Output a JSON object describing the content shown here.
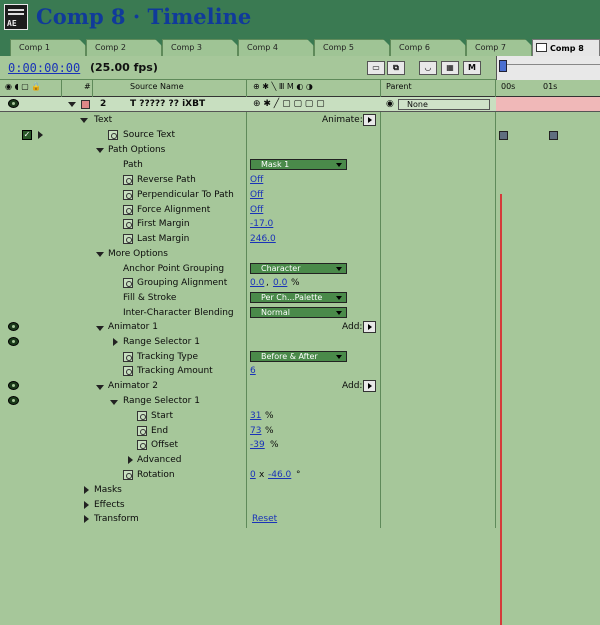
{
  "window": {
    "title": "Comp 8 · Timeline",
    "icon_label": "AE"
  },
  "tabs": [
    "Comp 1",
    "Comp 2",
    "Comp 3",
    "Comp 4",
    "Comp 5",
    "Comp 6",
    "Comp 7",
    "Comp 8"
  ],
  "active_tab": "Comp 8",
  "timecode": "0:00:00:00",
  "fps": "(25.00 fps)",
  "toolbar": {
    "m_label": "M"
  },
  "columns": {
    "hash": "#",
    "source_name": "Source Name",
    "parent": "Parent"
  },
  "ruler": {
    "t0": "00s",
    "t1": "01s"
  },
  "layer": {
    "number": "2",
    "name": "T ????? ?? iXBT",
    "parent": "None"
  },
  "labels": {
    "animate": "Animate:",
    "add1": "Add:",
    "add2": "Add:"
  },
  "props": [
    {
      "label": "Text"
    },
    {
      "label": "Source Text"
    },
    {
      "label": "Path Options"
    },
    {
      "label": "Path",
      "dropdown": "Mask 1"
    },
    {
      "label": "Reverse Path",
      "value": "Off"
    },
    {
      "label": "Perpendicular To Path",
      "value": "Off"
    },
    {
      "label": "Force Alignment",
      "value": "Off"
    },
    {
      "label": "First Margin",
      "value": "-17.0"
    },
    {
      "label": "Last Margin",
      "value": "246.0"
    },
    {
      "label": "More Options"
    },
    {
      "label": "Anchor Point Grouping",
      "dropdown": "Character"
    },
    {
      "label": "Grouping Alignment",
      "value": "0.0",
      "value2": "0.0",
      "unit": "%"
    },
    {
      "label": "Fill & Stroke",
      "dropdown": "Per Ch...Palette"
    },
    {
      "label": "Inter-Character Blending",
      "dropdown": "Normal"
    },
    {
      "label": "Animator 1"
    },
    {
      "label": "Range Selector 1"
    },
    {
      "label": "Tracking Type",
      "dropdown": "Before & After"
    },
    {
      "label": "Tracking Amount",
      "value": "6"
    },
    {
      "label": "Animator 2"
    },
    {
      "label": "Range Selector 1"
    },
    {
      "label": "Start",
      "value": "31",
      "unit": "%"
    },
    {
      "label": "End",
      "value": "73",
      "unit": "%"
    },
    {
      "label": "Offset",
      "value": "-39",
      "unit": "%"
    },
    {
      "label": "Advanced"
    },
    {
      "label": "Rotation",
      "value": "0",
      "sep": "x",
      "value2": "-46.0",
      "unit": "°"
    },
    {
      "label": "Masks"
    },
    {
      "label": "Effects"
    },
    {
      "label": "Transform",
      "value": "Reset"
    }
  ],
  "colors": {
    "timecode": "#1a33b8",
    "background": "#a6c79a",
    "window_chrome": "#3a7a52",
    "current_time": "#d53a3a"
  }
}
